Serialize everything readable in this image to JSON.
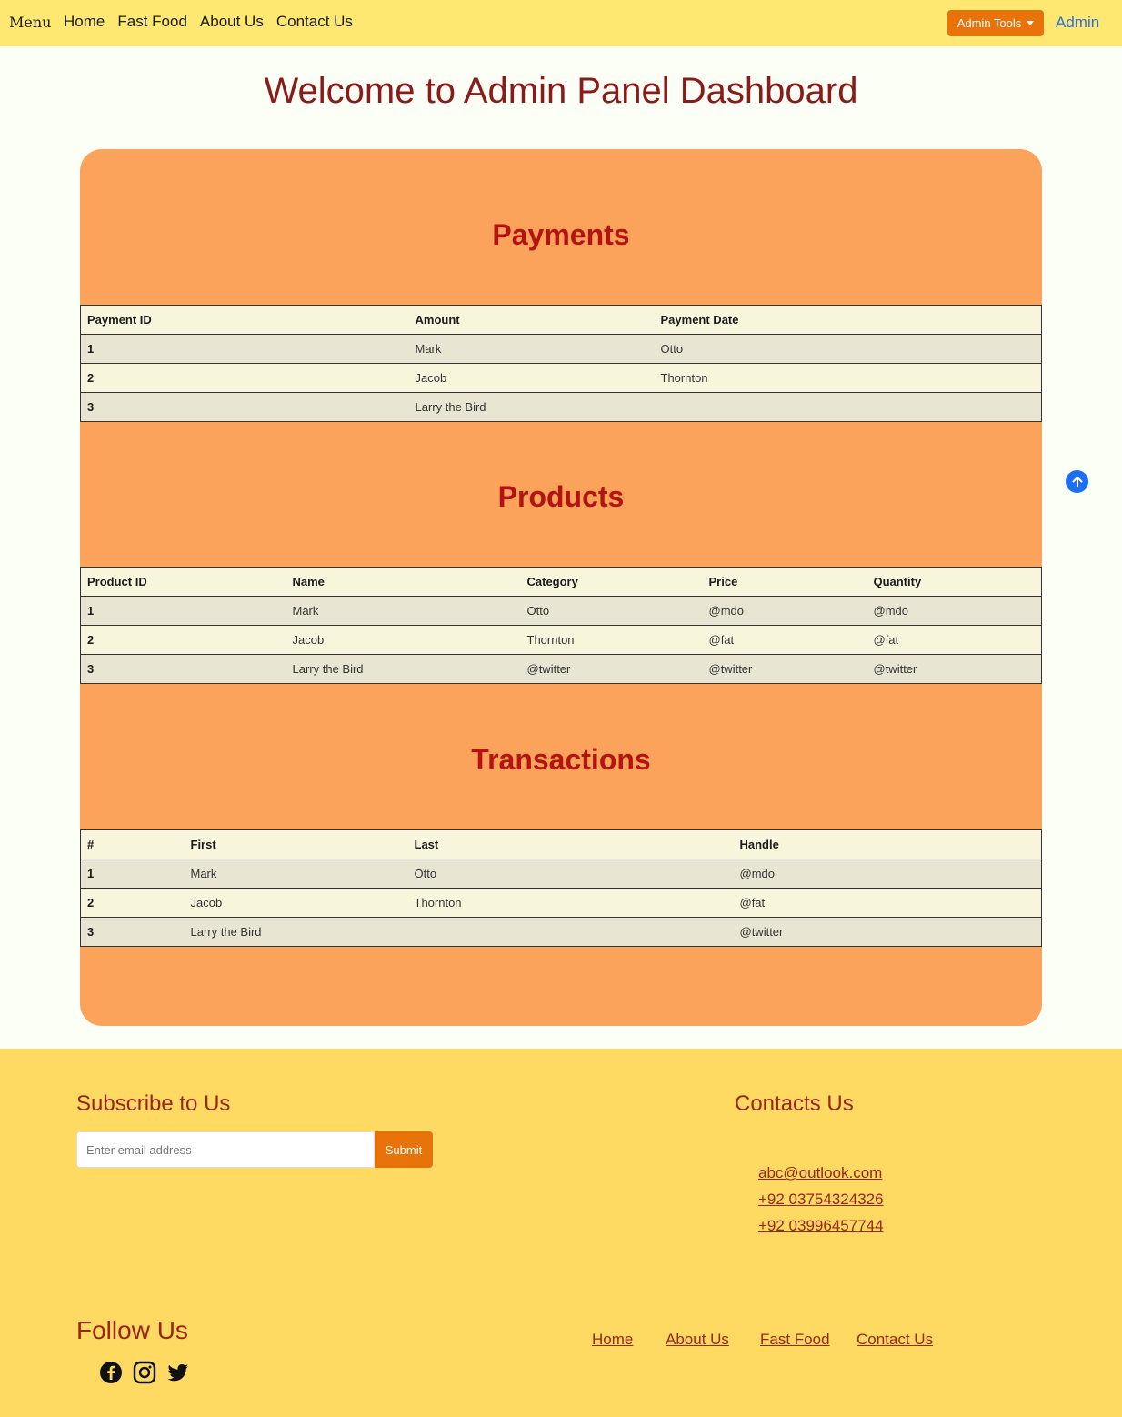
{
  "navbar": {
    "brand": "Menu",
    "links": [
      "Home",
      "Fast Food",
      "About Us",
      "Contact Us"
    ],
    "admin_tools": "Admin Tools",
    "admin": "Admin"
  },
  "page_title": "Welcome to Admin Panel Dashboard",
  "payments": {
    "title": "Payments",
    "headers": [
      "Payment ID",
      "Amount",
      "Payment Date"
    ],
    "rows": [
      [
        "1",
        "Mark",
        "Otto"
      ],
      [
        "2",
        "Jacob",
        "Thornton"
      ],
      [
        "3",
        "Larry the Bird",
        ""
      ]
    ]
  },
  "products": {
    "title": "Products",
    "headers": [
      "Product ID",
      "Name",
      "Category",
      "Price",
      "Quantity"
    ],
    "rows": [
      [
        "1",
        "Mark",
        "Otto",
        "@mdo",
        "@mdo"
      ],
      [
        "2",
        "Jacob",
        "Thornton",
        "@fat",
        "@fat"
      ],
      [
        "3",
        "Larry the Bird",
        "@twitter",
        "@twitter",
        "@twitter"
      ]
    ]
  },
  "transactions": {
    "title": "Transactions",
    "headers": [
      "#",
      "First",
      "Last",
      "Handle"
    ],
    "rows": [
      [
        "1",
        "Mark",
        "Otto",
        "@mdo"
      ],
      [
        "2",
        "Jacob",
        "Thornton",
        "@fat"
      ],
      [
        "3",
        "Larry the Bird",
        "",
        "@twitter"
      ]
    ]
  },
  "footer": {
    "subscribe_title": "Subscribe to Us",
    "email_placeholder": "Enter email address",
    "submit": "Submit",
    "contacts_title": "Contacts Us",
    "contacts": [
      "abc@outlook.com",
      "+92 03754324326",
      "+92 03996457744"
    ],
    "follow_title": "Follow Us",
    "nav_links": [
      "Home",
      "About Us",
      "Fast Food",
      "Contact Us"
    ],
    "social_icons": [
      "facebook-icon",
      "instagram-icon",
      "twitter-icon"
    ]
  },
  "colors": {
    "navbar_bg": "#ffe872",
    "accent": "#e8730a",
    "panel_bg": "#fba35b",
    "section_title": "#b51212",
    "footer_bg": "#ffda62",
    "footer_text": "#9b2416"
  }
}
